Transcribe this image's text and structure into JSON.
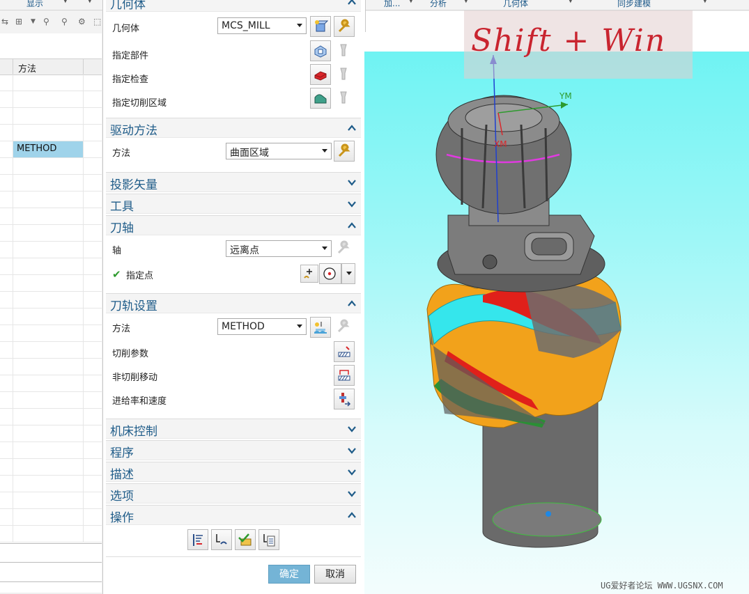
{
  "ribbon": {
    "items": [
      {
        "label": "显示"
      },
      {
        "label": "几何体"
      },
      {
        "label": "加..."
      },
      {
        "label": "分析"
      },
      {
        "label": "几何体"
      },
      {
        "label": "同步建模"
      }
    ]
  },
  "navigator": {
    "column_header": "方法",
    "selected_cell": "METHOD"
  },
  "dialog": {
    "geometry": {
      "title": "几何体",
      "geometry_label": "几何体",
      "geometry_value": "MCS_MILL",
      "part_label": "指定部件",
      "check_label": "指定检查",
      "cut_area_label": "指定切削区域"
    },
    "drive": {
      "title": "驱动方法",
      "method_label": "方法",
      "method_value": "曲面区域"
    },
    "projection": {
      "title": "投影矢量"
    },
    "tool": {
      "title": "工具"
    },
    "tool_axis": {
      "title": "刀轴",
      "axis_label": "轴",
      "axis_value": "远离点",
      "point_label": "指定点"
    },
    "path_settings": {
      "title": "刀轨设置",
      "method_label": "方法",
      "method_value": "METHOD",
      "cut_params_label": "切削参数",
      "non_cut_label": "非切削移动",
      "feeds_label": "进给率和速度"
    },
    "machine_control": {
      "title": "机床控制"
    },
    "program": {
      "title": "程序"
    },
    "description": {
      "title": "描述"
    },
    "options": {
      "title": "选项"
    },
    "actions": {
      "title": "操作"
    },
    "ok_label": "确定",
    "cancel_label": "取消"
  },
  "viewport": {
    "axis_y_label": "YM",
    "axis_x_label": "XM",
    "watermark_text": "Shift + Win",
    "site_text": "UG爱好者论坛 WWW.UGSNX.COM"
  },
  "colors": {
    "section_title": "#1f5c89",
    "selected_row": "#9fd3ea",
    "ok_button": "#74b4d6",
    "viewport_bg": "#6ff3f3"
  }
}
